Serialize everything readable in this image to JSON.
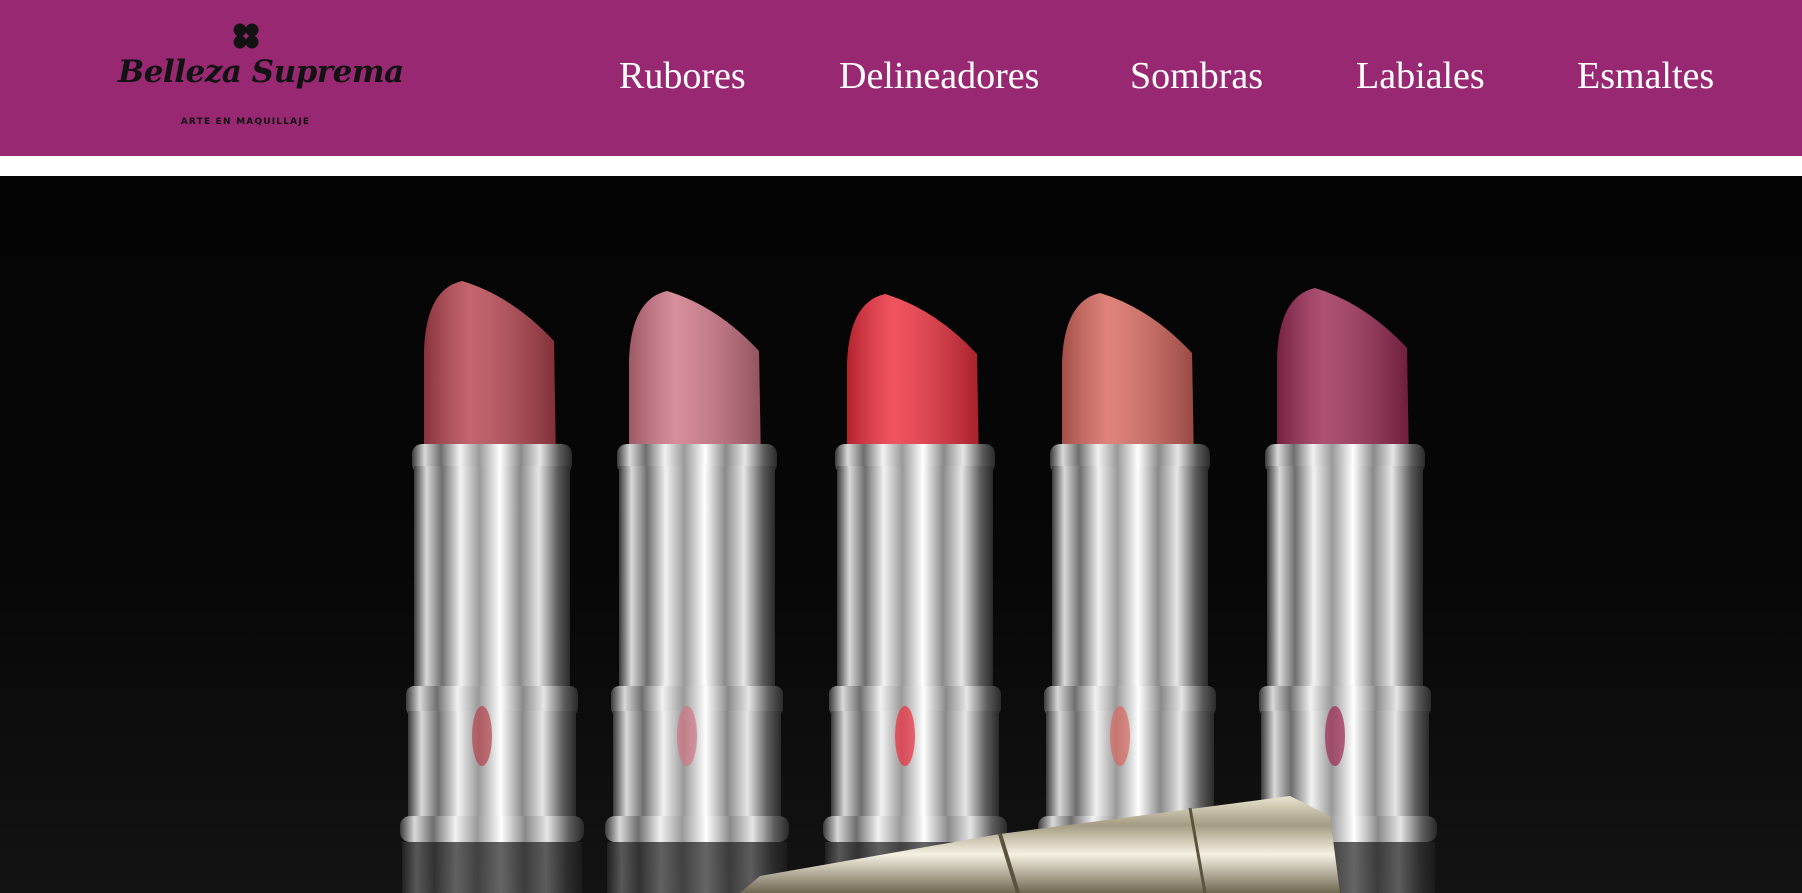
{
  "brand": {
    "name": "Belleza Suprema",
    "tagline": "ARTE EN MAQUILLAJE",
    "icon": "four-petal-flower-icon",
    "color": "#121212"
  },
  "nav": {
    "items": [
      {
        "label": "Rubores"
      },
      {
        "label": "Delineadores"
      },
      {
        "label": "Sombras"
      },
      {
        "label": "Labiales"
      },
      {
        "label": "Esmaltes"
      }
    ]
  },
  "hero": {
    "image": "lipsticks-photo",
    "background": "#040404",
    "lipstick_colors": [
      "#b7434f",
      "#cf7585",
      "#ee2e3d",
      "#d9685f",
      "#9c2b55"
    ]
  },
  "colors": {
    "header_bg": "#992873",
    "nav_text": "#ffffff",
    "page_bg": "#ffffff"
  }
}
